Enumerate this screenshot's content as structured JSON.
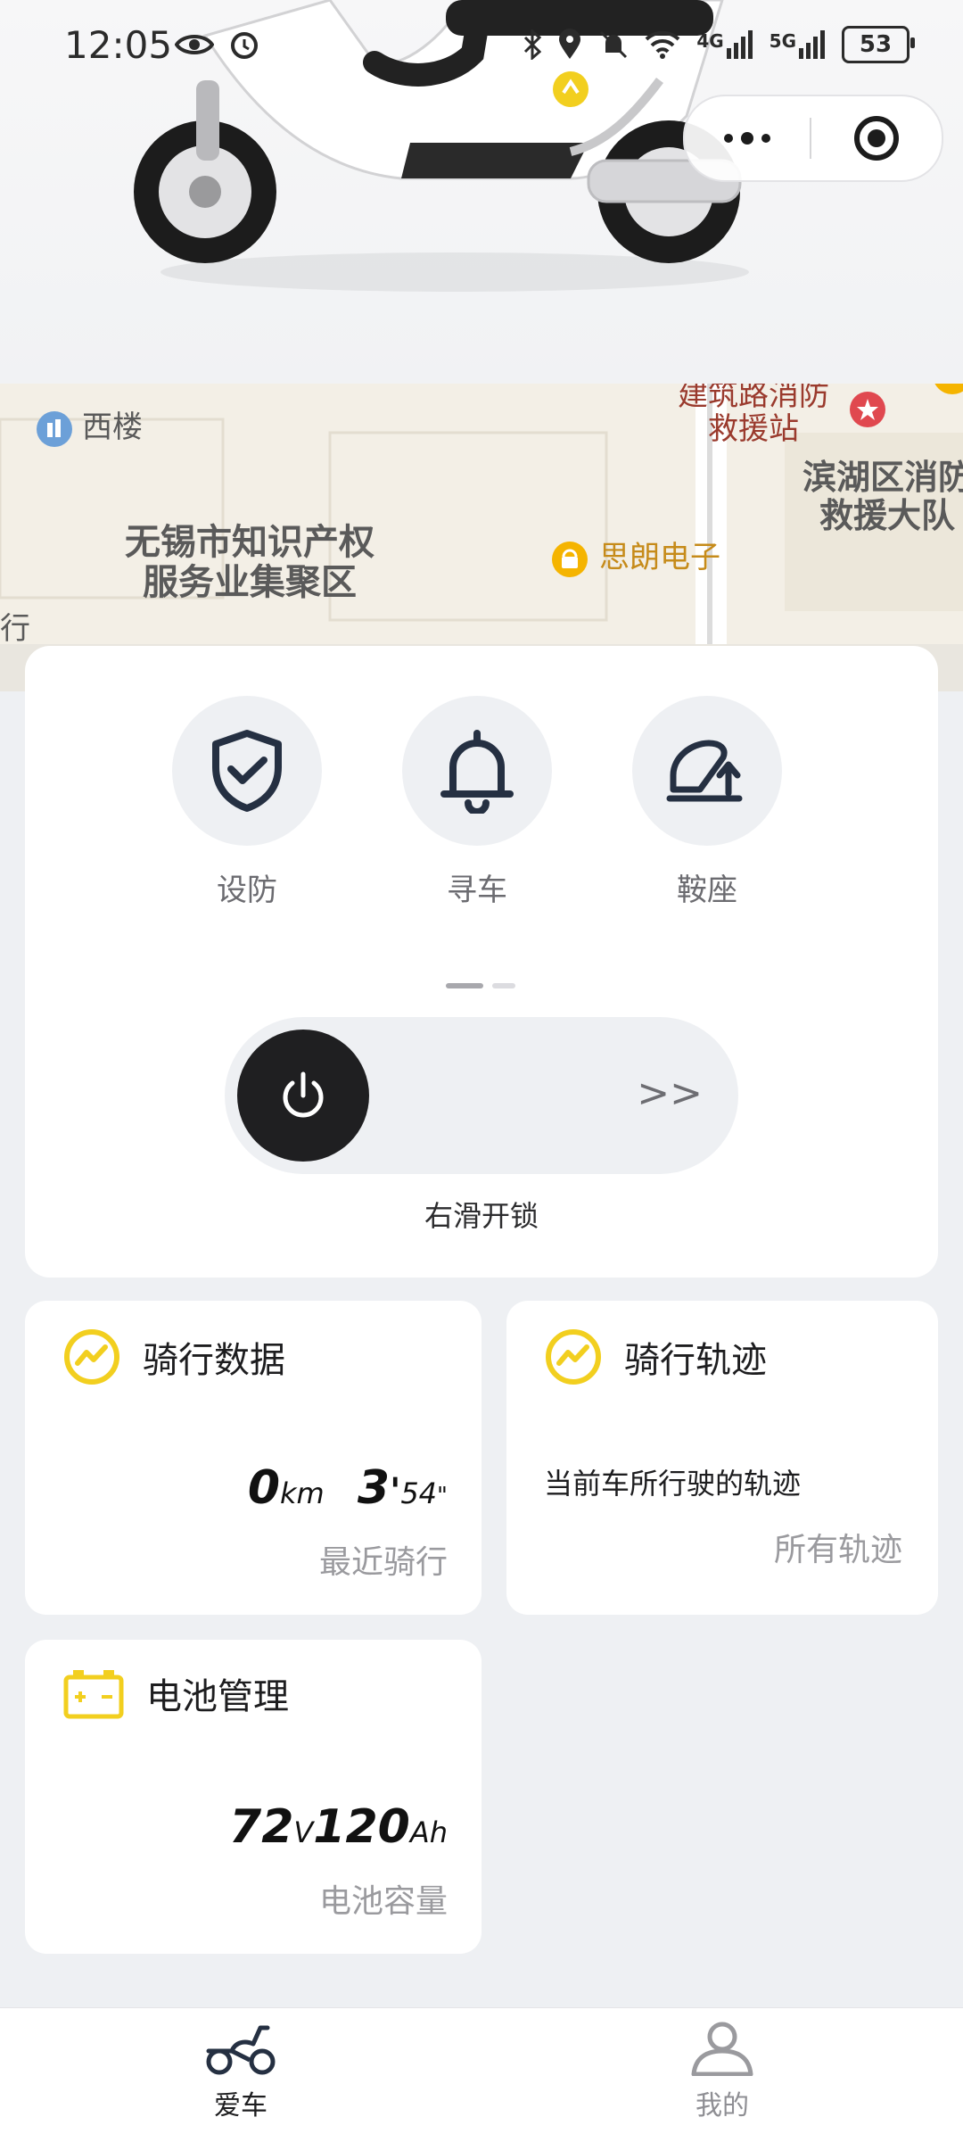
{
  "status_bar": {
    "time": "12:05",
    "network_1": "4G",
    "network_2": "5G",
    "battery": "53"
  },
  "map": {
    "labels": {
      "xilou": "西楼",
      "ip_district_line1": "无锡市知识产权",
      "ip_district_line2": "服务业集聚区",
      "simang": "思朗电子",
      "fire_station_line1": "建筑路消防",
      "fire_station_line2": "救援站",
      "binhu_line1": "滨湖区消防",
      "binhu_line2": "救援大队",
      "bank_fragment": "银行"
    }
  },
  "controls": {
    "buttons": [
      {
        "label": "设防",
        "icon": "shield-check-icon"
      },
      {
        "label": "寻车",
        "icon": "bell-icon"
      },
      {
        "label": "鞍座",
        "icon": "seat-lift-icon"
      }
    ],
    "pager_active": 0,
    "pager_count": 2,
    "slider_arrows": ">>",
    "slider_hint": "右滑开锁"
  },
  "riding_data": {
    "title": "骑行数据",
    "distance": "0",
    "distance_unit": "km",
    "minutes": "3",
    "minute_mark": "'",
    "seconds": "54",
    "second_mark": "\"",
    "subtitle": "最近骑行"
  },
  "riding_track": {
    "title": "骑行轨迹",
    "desc": "当前车所行驶的轨迹",
    "subtitle": "所有轨迹"
  },
  "battery_mgmt": {
    "title": "电池管理",
    "voltage": "72",
    "voltage_unit": "V",
    "capacity": "120",
    "capacity_unit": "Ah",
    "subtitle": "电池容量"
  },
  "bottom_nav": {
    "tabs": [
      {
        "label": "爱车",
        "icon": "scooter-icon",
        "active": true
      },
      {
        "label": "我的",
        "icon": "user-icon",
        "active": false
      }
    ]
  },
  "colors": {
    "accent_yellow": "#f2cf1f",
    "icon_dark": "#253042",
    "map_bg": "#f3efe6"
  }
}
